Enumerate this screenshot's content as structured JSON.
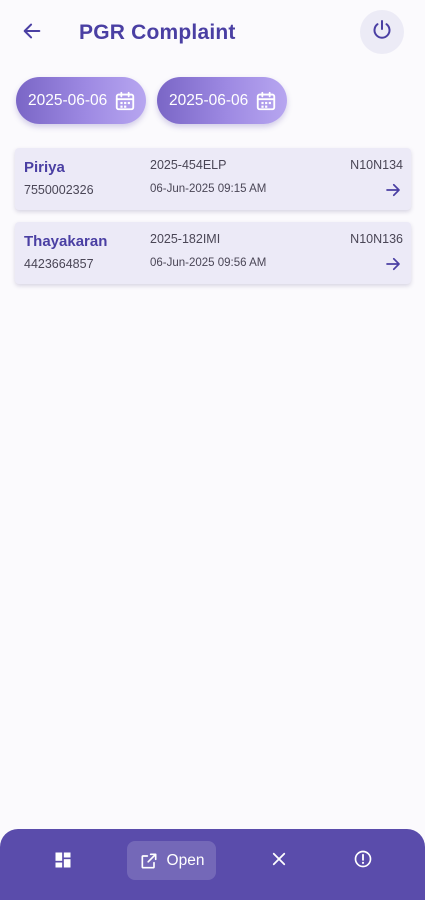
{
  "header": {
    "title": "PGR Complaint",
    "back_icon": "arrow-left-icon",
    "power_icon": "power-icon"
  },
  "filters": {
    "from_date": "2025-06-06",
    "to_date": "2025-06-06",
    "calendar_icon": "calendar-icon"
  },
  "complaints": [
    {
      "name": "Piriya",
      "phone": "7550002326",
      "complaint_id": "2025-454ELP",
      "datetime": "06-Jun-2025 09:15 AM",
      "code": "N10N134"
    },
    {
      "name": "Thayakaran",
      "phone": "4423664857",
      "complaint_id": "2025-182IMI",
      "datetime": "06-Jun-2025 09:56 AM",
      "code": "N10N136"
    }
  ],
  "bottom_bar": {
    "open_label": "Open",
    "icons": [
      "dashboard-icon",
      "open-external-icon",
      "close-icon",
      "info-icon"
    ]
  },
  "colors": {
    "accent": "#4a3fa3",
    "bottom_bar": "#5a4cab",
    "card_bg": "#eceaf7",
    "pill_gradient_start": "#7a66c6",
    "pill_gradient_end": "#b7a6f0"
  }
}
